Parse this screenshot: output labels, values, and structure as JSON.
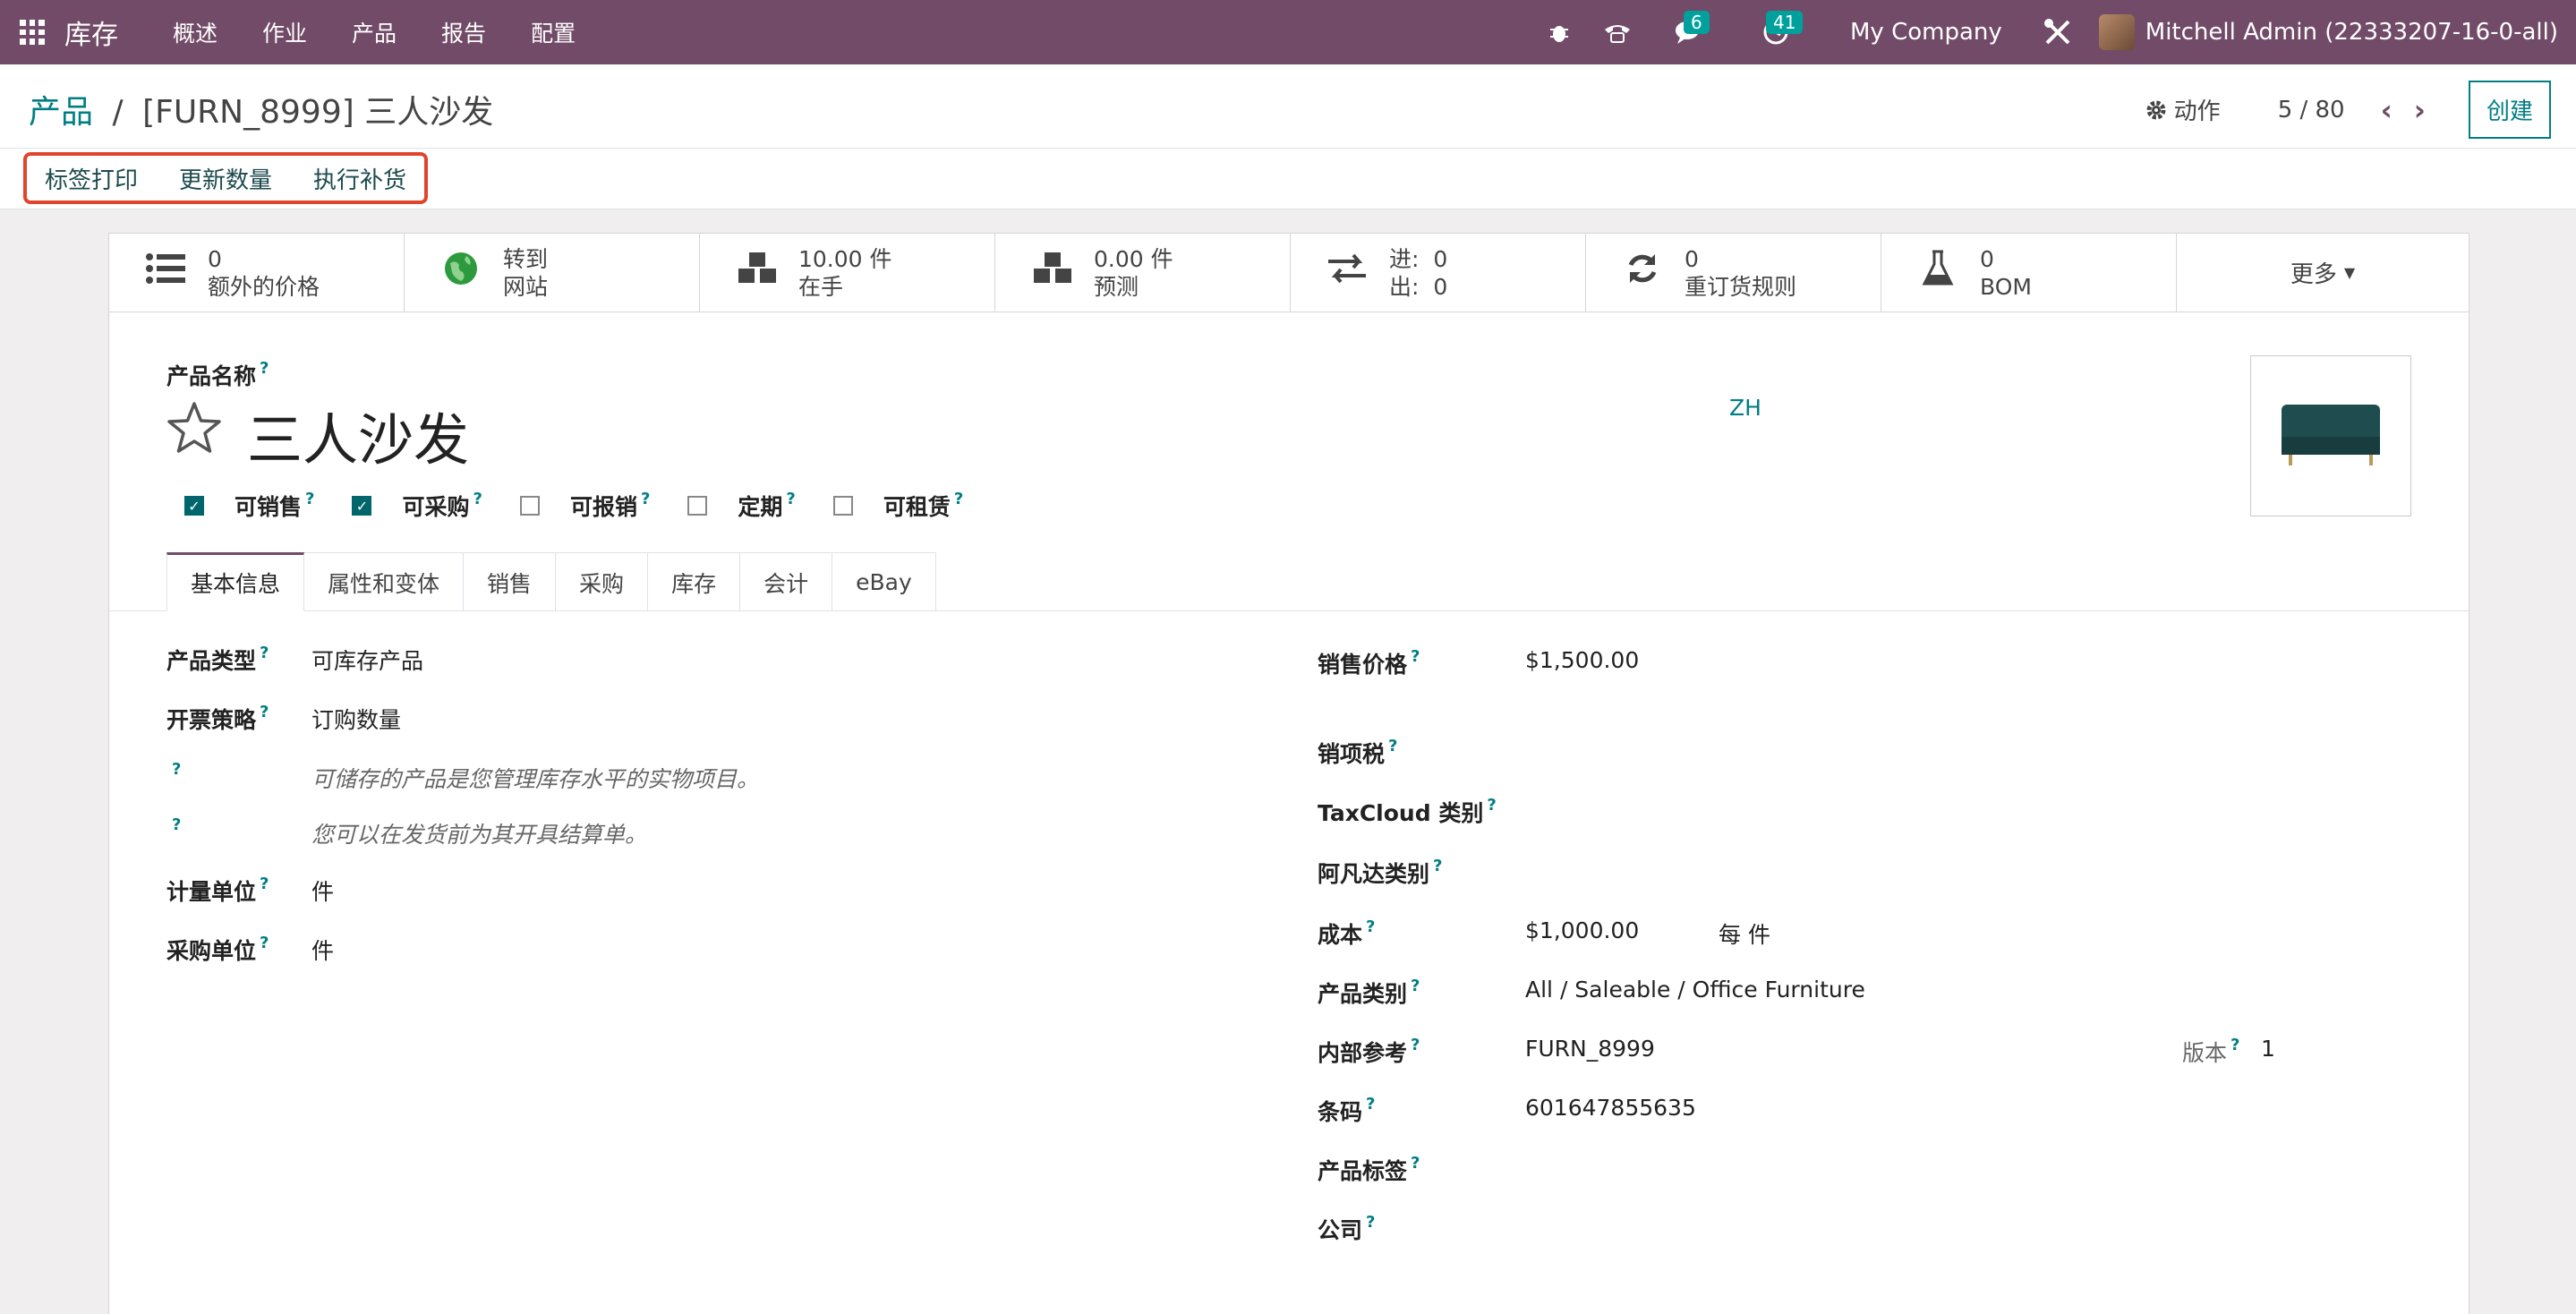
{
  "navbar": {
    "brand": "库存",
    "menu": [
      "概述",
      "作业",
      "产品",
      "报告",
      "配置"
    ],
    "chat_count": "6",
    "activity_count": "41",
    "company": "My Company",
    "user": "Mitchell Admin (22333207-16-0-all)"
  },
  "breadcrumb": {
    "parent": "产品",
    "separator": "/",
    "current": "[FURN_8999] 三人沙发"
  },
  "control": {
    "action_label": "动作",
    "pager": "5 / 80",
    "create_label": "创建",
    "header_buttons": [
      "标签打印",
      "更新数量",
      "执行补货"
    ]
  },
  "stats": [
    {
      "icon": "list-icon",
      "line1": "0",
      "line2": "额外的价格"
    },
    {
      "icon": "globe-icon",
      "line1": "转到",
      "line2": "网站"
    },
    {
      "icon": "cubes-icon",
      "line1": "10.00 件",
      "line2": "在手"
    },
    {
      "icon": "cubes-icon",
      "line1": "0.00 件",
      "line2": "预测"
    },
    {
      "icon": "exchange-icon",
      "line1": "进:  0",
      "line2": "出:  0"
    },
    {
      "icon": "refresh-icon",
      "line1": "0",
      "line2": "重订货规则"
    },
    {
      "icon": "flask-icon",
      "line1": "0",
      "line2": "BOM"
    }
  ],
  "stats_more": "更多",
  "product": {
    "name_label": "产品名称",
    "name": "三人沙发",
    "lang": "ZH",
    "q": "?",
    "checks": [
      {
        "label": "可销售",
        "checked": true
      },
      {
        "label": "可采购",
        "checked": true
      },
      {
        "label": "可报销",
        "checked": false
      },
      {
        "label": "定期",
        "checked": false
      },
      {
        "label": "可租赁",
        "checked": false
      }
    ]
  },
  "tabs": [
    "基本信息",
    "属性和变体",
    "销售",
    "采购",
    "库存",
    "会计",
    "eBay"
  ],
  "left_fields": {
    "type_label": "产品类型",
    "type_value": "可库存产品",
    "invoice_label": "开票策略",
    "invoice_value": "订购数量",
    "help1": "可储存的产品是您管理库存水平的实物项目。",
    "help2": "您可以在发货前为其开具结算单。",
    "uom_label": "计量单位",
    "uom_value": "件",
    "po_uom_label": "采购单位",
    "po_uom_value": "件"
  },
  "right_fields": {
    "price_label": "销售价格",
    "price_value": "$1,500.00",
    "tax_label": "销项税",
    "taxcloud_label": "TaxCloud 类别",
    "avatax_label": "阿凡达类别",
    "cost_label": "成本",
    "cost_value": "$1,000.00",
    "cost_unit": "每 件",
    "categ_label": "产品类别",
    "categ_value": "All / Saleable / Office Furniture",
    "ref_label": "内部参考",
    "ref_value": "FURN_8999",
    "version_label": "版本",
    "version_value": "1",
    "barcode_label": "条码",
    "barcode_value": "601647855635",
    "tags_label": "产品标签",
    "company_label": "公司"
  }
}
